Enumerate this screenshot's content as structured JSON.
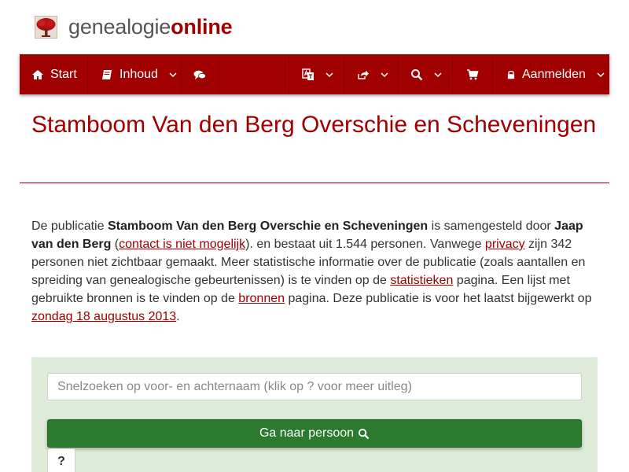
{
  "logo": {
    "part1": "genealogie",
    "part2": "online",
    "icon": "tree-icon"
  },
  "nav": {
    "start": {
      "label": "Start",
      "icon": "home-icon"
    },
    "inhoud": {
      "label": "Inhoud",
      "icon": "book-icon"
    },
    "comments": {
      "icon": "comments-icon"
    },
    "language": {
      "icon": "translate-icon"
    },
    "share": {
      "icon": "share-icon"
    },
    "search": {
      "icon": "search-icon"
    },
    "cart": {
      "icon": "shopping-cart-icon"
    },
    "login": {
      "label": "Aanmelden",
      "icon": "lock-icon"
    }
  },
  "page": {
    "title": "Stamboom Van den Berg Overschie en Scheveningen"
  },
  "intro": {
    "t1": "De publicatie ",
    "pub_name": "Stamboom Van den Berg Overschie en Scheveningen",
    "t2": " is samengesteld door ",
    "author": "Jaap van den Berg",
    "t3": " (",
    "contact_link": "contact is niet mogelijk",
    "t4": "). en bestaat uit 1.544 personen. Vanwege ",
    "privacy_link": "privacy",
    "t5": " zijn 342 personen niet zichtbaar gemaakt. Meer statistische informatie over de publicatie (zoals aantallen en spreiding van genealogische gebeurtenissen) is te vinden op de ",
    "stats_link": "statistieken",
    "t6": " pagina. Een lijst met gebruikte bronnen is te vinden op de ",
    "sources_link": "bronnen",
    "t7": " pagina. Deze publicatie is voor het laatst bijgewerkt op ",
    "date_link": "zondag 18 augustus 2013",
    "t8": "."
  },
  "search": {
    "placeholder": "Snelzoeken op voor- en achternaam (klik op ? voor meer uitleg)",
    "button_label": "Ga naar persoon",
    "help_label": "?"
  },
  "colors": {
    "brand": "#a00000",
    "panel": "#dfecd9",
    "button": "#2b7a2e"
  }
}
